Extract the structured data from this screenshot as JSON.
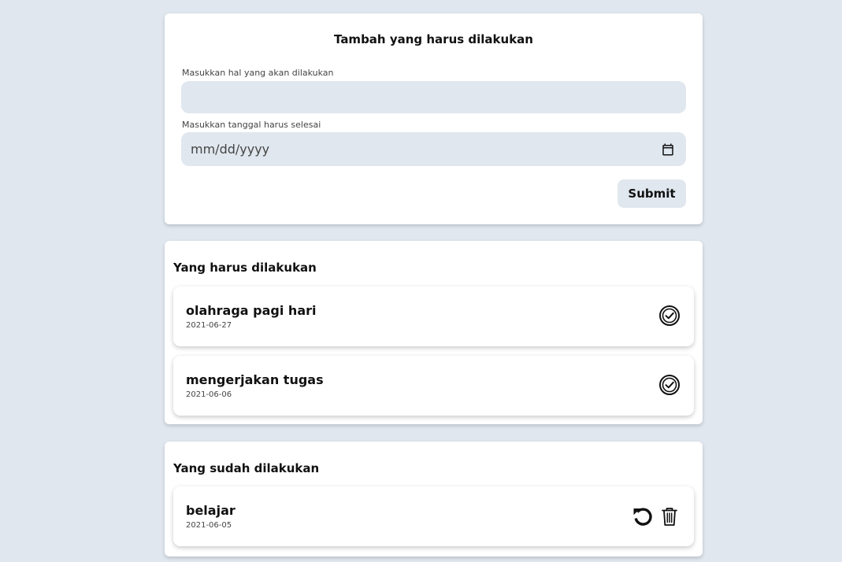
{
  "form": {
    "title": "Tambah yang harus dilakukan",
    "todo_label": "Masukkan hal yang akan dilakukan",
    "todo_value": "",
    "date_label": "Masukkan tanggal harus selesai",
    "date_placeholder": "mm/dd/yyyy",
    "submit_label": "Submit"
  },
  "todo_section": {
    "title": "Yang harus dilakukan",
    "items": [
      {
        "title": "olahraga pagi hari",
        "date": "2021-06-27",
        "action_icon": "check-circle-icon"
      },
      {
        "title": "mengerjakan tugas",
        "date": "2021-06-06",
        "action_icon": "check-circle-icon"
      }
    ]
  },
  "done_section": {
    "title": "Yang sudah dilakukan",
    "items": [
      {
        "title": "belajar",
        "date": "2021-06-05",
        "action_icons": [
          "undo-icon",
          "trash-icon"
        ]
      }
    ]
  },
  "colors": {
    "background": "#e0e7ef",
    "card": "#ffffff",
    "input": "#e0e7ef",
    "text": "#111111"
  }
}
